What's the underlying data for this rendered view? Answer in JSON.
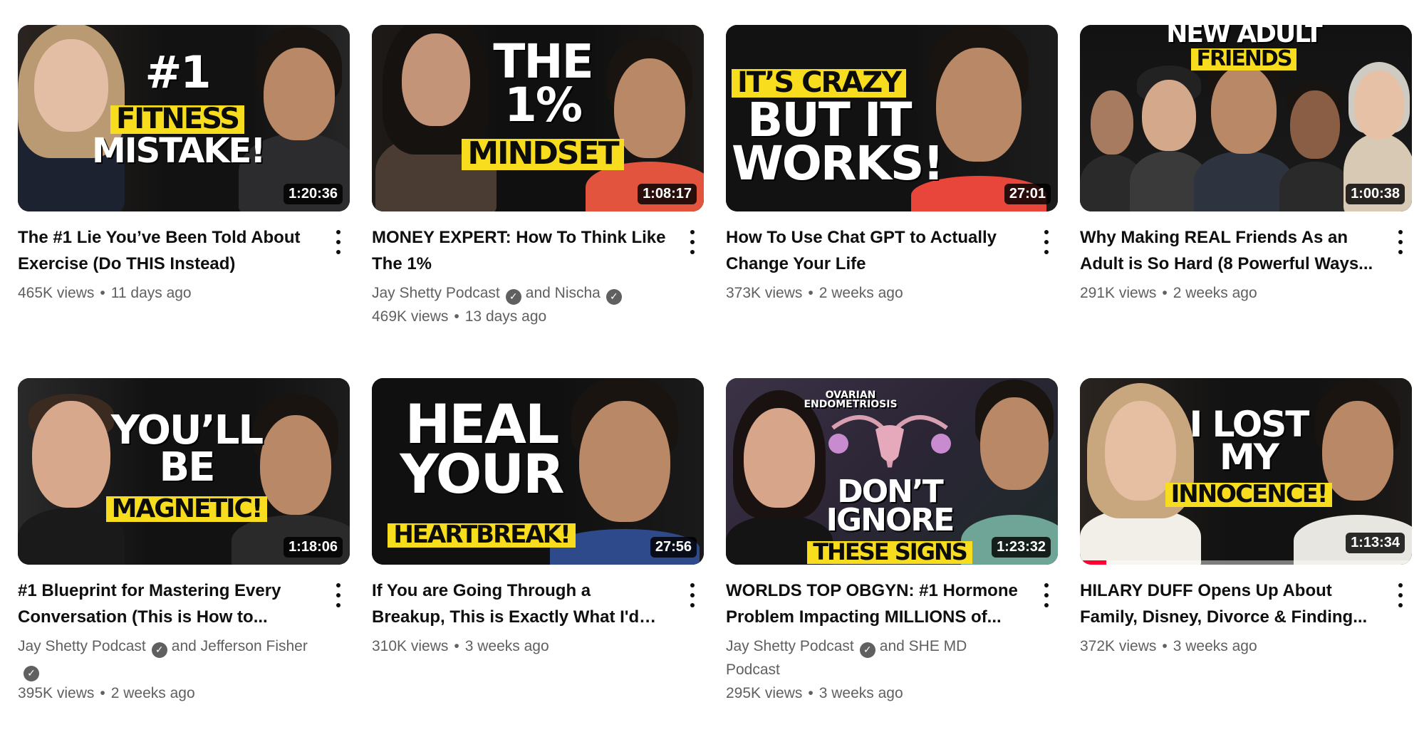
{
  "videos": [
    {
      "title": "The #1 Lie You’ve Been Told About Exercise (Do THIS Instead)",
      "duration": "1:20:36",
      "thumb_text": [
        "#1",
        "FITNESS",
        "MISTAKE!"
      ],
      "views": "465K views",
      "age": "11 days ago"
    },
    {
      "title": "MONEY EXPERT: How To Think Like The 1%",
      "duration": "1:08:17",
      "thumb_text": [
        "THE",
        "1%",
        "MINDSET"
      ],
      "channel": "Jay Shetty Podcast",
      "collab_prefix": "and",
      "collab": "Nischa",
      "views": "469K views",
      "age": "13 days ago"
    },
    {
      "title": "How To Use Chat GPT to Actually Change Your Life",
      "duration": "27:01",
      "thumb_text": [
        "IT’S CRAZY",
        "BUT IT",
        "WORKS!"
      ],
      "views": "373K views",
      "age": "2 weeks ago"
    },
    {
      "title": "Why Making REAL Friends As an Adult is So Hard (8 Powerful Ways...",
      "duration": "1:00:38",
      "thumb_text": [
        "NEW ADULT",
        "FRIENDS"
      ],
      "views": "291K views",
      "age": "2 weeks ago"
    },
    {
      "title": "#1 Blueprint for Mastering Every Conversation (This is How to...",
      "duration": "1:18:06",
      "thumb_text": [
        "YOU’LL",
        "BE",
        "MAGNETIC!"
      ],
      "channel": "Jay Shetty Podcast",
      "collab_prefix": "and",
      "collab": "Jefferson Fisher",
      "views": "395K views",
      "age": "2 weeks ago"
    },
    {
      "title": "If You are Going Through a Breakup, This is Exactly What I'd Tell You",
      "duration": "27:56",
      "thumb_text": [
        "HEAL",
        "YOUR",
        "HEARTBREAK!"
      ],
      "views": "310K views",
      "age": "3 weeks ago"
    },
    {
      "title": "WORLDS TOP OBGYN: #1 Hormone Problem Impacting MILLIONS of...",
      "duration": "1:23:32",
      "thumb_text": [
        "OVARIAN",
        "ENDOMETRIOSIS",
        "DON’T",
        "IGNORE",
        "THESE SIGNS"
      ],
      "channel": "Jay Shetty Podcast",
      "collab_prefix": "and",
      "collab": "SHE MD Podcast",
      "views": "295K views",
      "age": "3 weeks ago"
    },
    {
      "title": "HILARY DUFF Opens Up About Family, Disney, Divorce & Finding...",
      "duration": "1:13:34",
      "thumb_text": [
        "I LOST",
        "MY",
        "INNOCENCE!"
      ],
      "views": "372K views",
      "age": "3 weeks ago",
      "watch_progress": 0.08
    }
  ],
  "ui": {
    "separator": "•",
    "verified_glyph": "✓",
    "menu_icon": "more-vertical-icon",
    "colors": {
      "thumb_yellow": "#f7dd1d",
      "meta_gray": "#606060",
      "progress_red": "#ff0033"
    }
  }
}
